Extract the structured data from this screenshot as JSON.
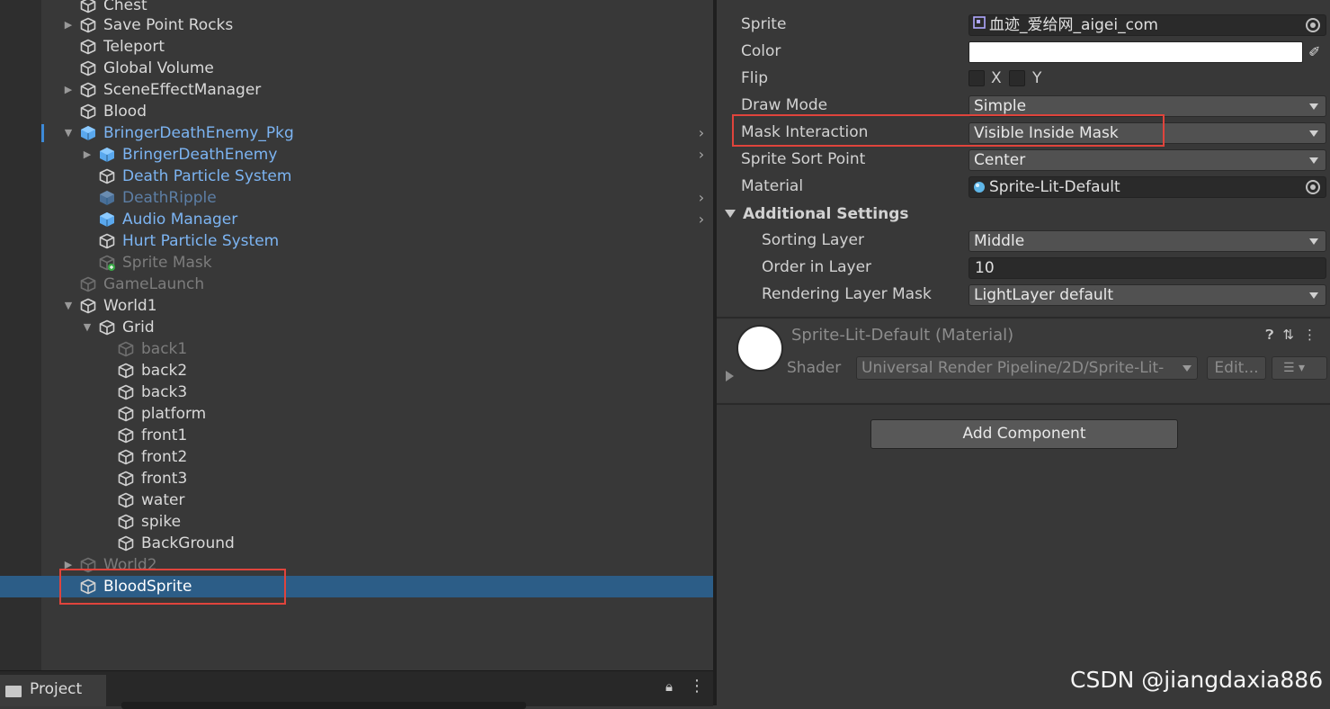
{
  "hierarchy": {
    "rows": [
      {
        "label": "Chest",
        "style": "normal"
      },
      {
        "label": "Save Point Rocks",
        "style": "normal"
      },
      {
        "label": "Teleport",
        "style": "normal"
      },
      {
        "label": "Global Volume",
        "style": "normal"
      },
      {
        "label": "SceneEffectManager",
        "style": "normal"
      },
      {
        "label": "Blood",
        "style": "normal"
      },
      {
        "label": "BringerDeathEnemy_Pkg",
        "style": "prefab"
      },
      {
        "label": "BringerDeathEnemy",
        "style": "prefab"
      },
      {
        "label": "Death Particle System",
        "style": "prefab"
      },
      {
        "label": "DeathRipple",
        "style": "prefab-dim"
      },
      {
        "label": "Audio Manager",
        "style": "prefab"
      },
      {
        "label": "Hurt Particle System",
        "style": "prefab"
      },
      {
        "label": "Sprite Mask",
        "style": "dim"
      },
      {
        "label": "GameLaunch",
        "style": "dim"
      },
      {
        "label": "World1",
        "style": "normal"
      },
      {
        "label": "Grid",
        "style": "normal"
      },
      {
        "label": "back1",
        "style": "dim"
      },
      {
        "label": "back2",
        "style": "normal"
      },
      {
        "label": "back3",
        "style": "normal"
      },
      {
        "label": "platform",
        "style": "normal"
      },
      {
        "label": "front1",
        "style": "normal"
      },
      {
        "label": "front2",
        "style": "normal"
      },
      {
        "label": "front3",
        "style": "normal"
      },
      {
        "label": "water",
        "style": "normal"
      },
      {
        "label": "spike",
        "style": "normal"
      },
      {
        "label": "BackGround",
        "style": "normal"
      },
      {
        "label": "World2",
        "style": "dim"
      },
      {
        "label": "BloodSprite",
        "style": "selected"
      }
    ]
  },
  "project_panel": {
    "tab_label": "Project",
    "lock_icon": "lock-icon",
    "menu_icon": "kebab-menu-icon"
  },
  "inspector": {
    "sprite": {
      "label": "Sprite",
      "value": "血迹_爱给网_aigei_com"
    },
    "color": {
      "label": "Color",
      "value": "#ffffff"
    },
    "flip": {
      "label": "Flip",
      "x": "X",
      "y": "Y"
    },
    "draw_mode": {
      "label": "Draw Mode",
      "value": "Simple"
    },
    "mask_interaction": {
      "label": "Mask Interaction",
      "value": "Visible Inside Mask"
    },
    "sprite_sort_point": {
      "label": "Sprite Sort Point",
      "value": "Center"
    },
    "material": {
      "label": "Material",
      "value": "Sprite-Lit-Default"
    },
    "additional_settings": {
      "header": "Additional Settings",
      "sorting_layer": {
        "label": "Sorting Layer",
        "value": "Middle"
      },
      "order_in_layer": {
        "label": "Order in Layer",
        "value": "10"
      },
      "rendering_layer_mask": {
        "label": "Rendering Layer Mask",
        "value": "LightLayer default"
      }
    },
    "material_block": {
      "name": "Sprite-Lit-Default (Material)",
      "shader_label": "Shader",
      "shader_value": "Universal Render Pipeline/2D/Sprite-Lit-",
      "edit_label": "Edit..."
    },
    "add_component_label": "Add Component"
  },
  "watermark": "CSDN @jiangdaxia886",
  "colors": {
    "highlight_box": "#e0443c",
    "selection": "#2c5d87",
    "prefab_text": "#7cb4f2"
  }
}
